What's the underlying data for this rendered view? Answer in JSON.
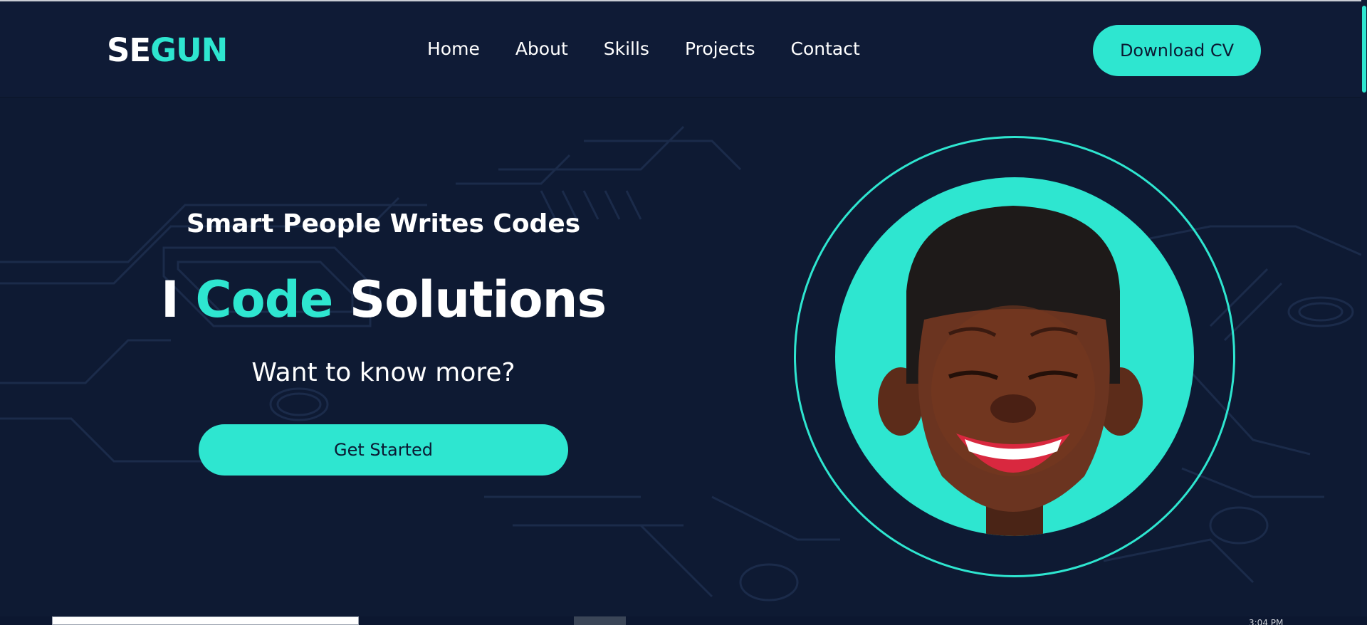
{
  "logo": {
    "part1": "SE",
    "part2": "GUN"
  },
  "nav": {
    "items": [
      "Home",
      "About",
      "Skills",
      "Projects",
      "Contact"
    ]
  },
  "header": {
    "cta_label": "Download CV"
  },
  "hero": {
    "kicker": "Smart People Writes Codes",
    "headline": {
      "prefix": "I ",
      "accent": "Code",
      "suffix": " Solutions"
    },
    "question": "Want to know more?",
    "cta_label": "Get Started"
  },
  "bottom_bar": {
    "clipped_text": "3:04 PM"
  },
  "colors": {
    "background": "#0e1a33",
    "accent": "#2ee6d0",
    "text": "#ffffff"
  },
  "icons": {
    "portrait": "avatar-illustration"
  }
}
